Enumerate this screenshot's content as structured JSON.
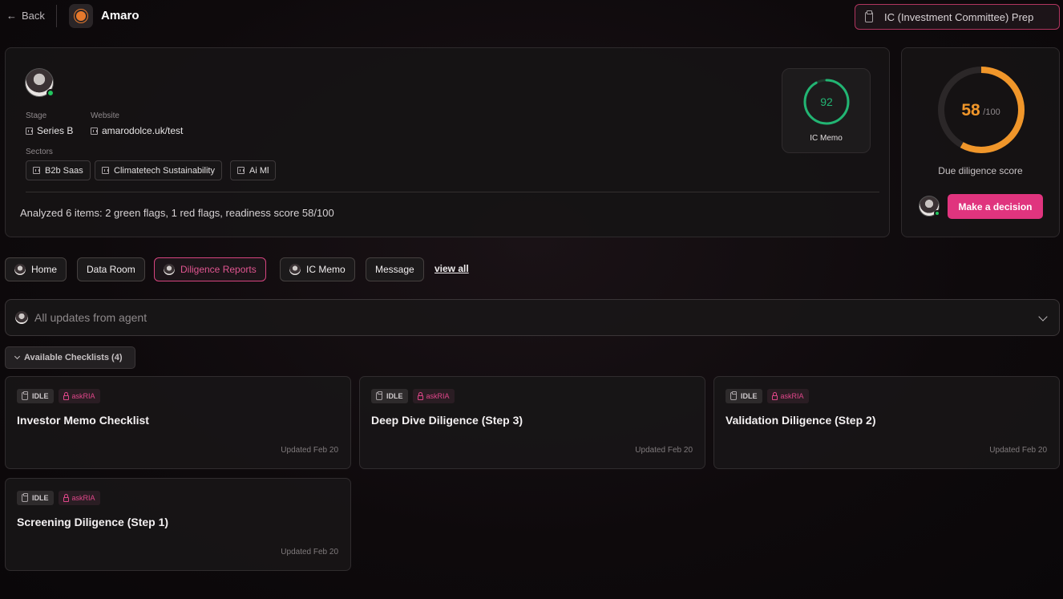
{
  "header": {
    "back_label": "Back",
    "company_name": "Amaro",
    "ic_prep_label": "IC (Investment Committee) Prep"
  },
  "profile": {
    "stage_label": "Stage",
    "stage_value": "Series B",
    "website_label": "Website",
    "website_value": "amarodolce.uk/test",
    "sectors_label": "Sectors",
    "sectors": [
      "B2b Saas",
      "Climatetech Sustainability",
      "Ai Ml"
    ],
    "summary": "Analyzed 6 items: 2 green flags, 1 red flags, readiness score 58/100",
    "ic_memo_score": "92",
    "ic_memo_label": "IC Memo"
  },
  "score": {
    "value": "58",
    "max": "/100",
    "fraction": 0.58,
    "label": "Due diligence score",
    "decision_button": "Make a decision"
  },
  "tabs": [
    "Home",
    "Data Room",
    "Diligence Reports",
    "IC Memo",
    "Message"
  ],
  "view_all": "view all",
  "updates_label": "All updates from agent",
  "checklists_toggle": "Available Checklists (4)",
  "checklists": [
    {
      "status": "IDLE",
      "tag": "askRIA",
      "title": "Investor Memo Checklist",
      "updated": "Updated Feb 20"
    },
    {
      "status": "IDLE",
      "tag": "askRIA",
      "title": "Deep Dive Diligence (Step 3)",
      "updated": "Updated Feb 20"
    },
    {
      "status": "IDLE",
      "tag": "askRIA",
      "title": "Validation Diligence (Step 2)",
      "updated": "Updated Feb 20"
    },
    {
      "status": "IDLE",
      "tag": "askRIA",
      "title": "Screening Diligence (Step 1)",
      "updated": "Updated Feb 20"
    }
  ],
  "colors": {
    "accent_pink": "#e0347e",
    "score_orange": "#f0962a",
    "memo_green": "#22b573"
  }
}
